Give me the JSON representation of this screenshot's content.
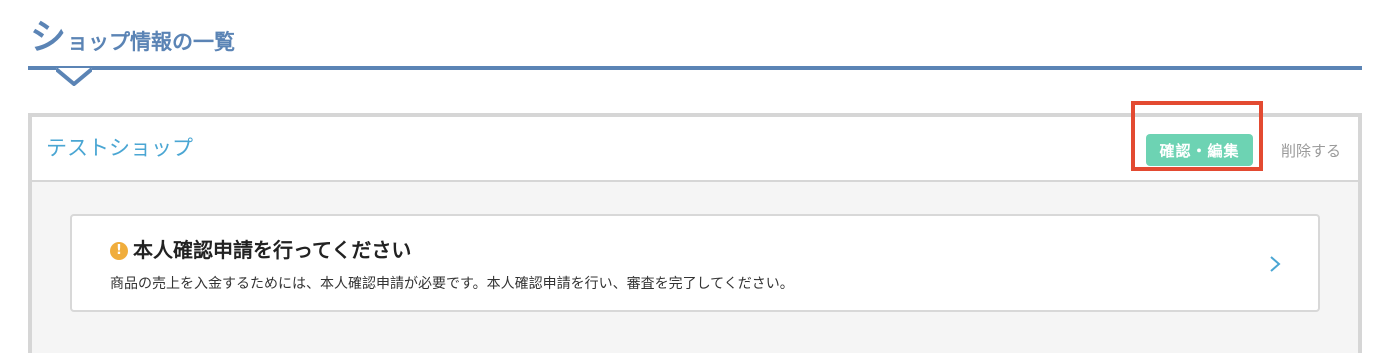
{
  "page": {
    "title_first": "シ",
    "title_rest": "ョップ情報の一覧"
  },
  "shop": {
    "name": "テストショップ",
    "edit_label": "確認・編集",
    "delete_label": "削除する"
  },
  "notice": {
    "icon": "!",
    "title": "本人確認申請を行ってください",
    "body": "商品の売上を入金するためには、本人確認申請が必要です。本人確認申請を行い、審査を完了してください。"
  },
  "colors": {
    "accent": "#5b84b5",
    "shop_name": "#4aa6d3",
    "edit_button": "#6dd3b3",
    "highlight": "#e34a31",
    "warning": "#f0ad3c"
  }
}
